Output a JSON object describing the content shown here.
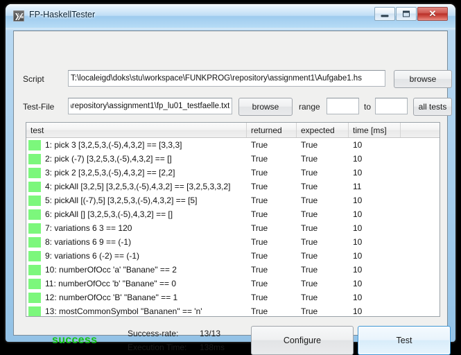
{
  "window": {
    "title": "FP-HaskellTester",
    "icon": "haskell-logo-icon",
    "minimize_label": "",
    "maximize_label": "",
    "close_label": "✕"
  },
  "form": {
    "script_label": "Script",
    "script_value": "T:\\localeigd\\doks\\stu\\workspace\\FUNKPROG\\repository\\assignment1\\Aufgabe1.hs",
    "script_browse_label": "browse",
    "testfile_label": "Test-File",
    "testfile_value": "i\\repository\\assignment1\\fp_lu01_testfaelle.txt",
    "testfile_browse_label": "browse",
    "range_label": "range",
    "range_from_value": "",
    "range_to_label": "to",
    "range_to_value": "",
    "all_tests_label": "all tests"
  },
  "table": {
    "columns": [
      "test",
      "returned",
      "expected",
      "time [ms]",
      ""
    ],
    "rows": [
      {
        "status": "pass",
        "test": "1: pick 3 [3,2,5,3,(-5),4,3,2] == [3,3,3]",
        "returned": "True",
        "expected": "True",
        "time": "10"
      },
      {
        "status": "pass",
        "test": "2: pick (-7) [3,2,5,3,(-5),4,3,2] == []",
        "returned": "True",
        "expected": "True",
        "time": "10"
      },
      {
        "status": "pass",
        "test": "3: pick 2 [3,2,5,3,(-5),4,3,2] == [2,2]",
        "returned": "True",
        "expected": "True",
        "time": "10"
      },
      {
        "status": "pass",
        "test": "4: pickAll [3,2,5] [3,2,5,3,(-5),4,3,2] == [3,2,5,3,3,2]",
        "returned": "True",
        "expected": "True",
        "time": "11"
      },
      {
        "status": "pass",
        "test": "5: pickAll [(-7),5] [3,2,5,3,(-5),4,3,2] == [5]",
        "returned": "True",
        "expected": "True",
        "time": "10"
      },
      {
        "status": "pass",
        "test": "6: pickAll [] [3,2,5,3,(-5),4,3,2] == []",
        "returned": "True",
        "expected": "True",
        "time": "10"
      },
      {
        "status": "pass",
        "test": "7: variations 6 3 == 120",
        "returned": "True",
        "expected": "True",
        "time": "10"
      },
      {
        "status": "pass",
        "test": "8: variations 6 9 == (-1)",
        "returned": "True",
        "expected": "True",
        "time": "10"
      },
      {
        "status": "pass",
        "test": "9: variations 6 (-2) == (-1)",
        "returned": "True",
        "expected": "True",
        "time": "10"
      },
      {
        "status": "pass",
        "test": "10: numberOfOcc 'a' \"Banane\" == 2",
        "returned": "True",
        "expected": "True",
        "time": "10"
      },
      {
        "status": "pass",
        "test": "11: numberOfOcc 'b' \"Banane\" == 0",
        "returned": "True",
        "expected": "True",
        "time": "10"
      },
      {
        "status": "pass",
        "test": "12: numberOfOcc 'B' \"Banane\" == 1",
        "returned": "True",
        "expected": "True",
        "time": "10"
      },
      {
        "status": "pass",
        "test": "13: mostCommonSymbol \"Bananen\" == 'n'",
        "returned": "True",
        "expected": "True",
        "time": "10"
      }
    ]
  },
  "status": {
    "result_word": "success",
    "success_rate_label": "Success-rate:",
    "success_rate_value": "13/13",
    "execution_time_label": "Execution Time:",
    "execution_time_value": "138ms"
  },
  "actions": {
    "configure_label": "Configure",
    "test_label": "Test"
  },
  "colors": {
    "pass_swatch": "#7cf77c",
    "success_text": "#14c414",
    "window_border": "#93c2e6",
    "focus_border": "#3c94d4"
  }
}
